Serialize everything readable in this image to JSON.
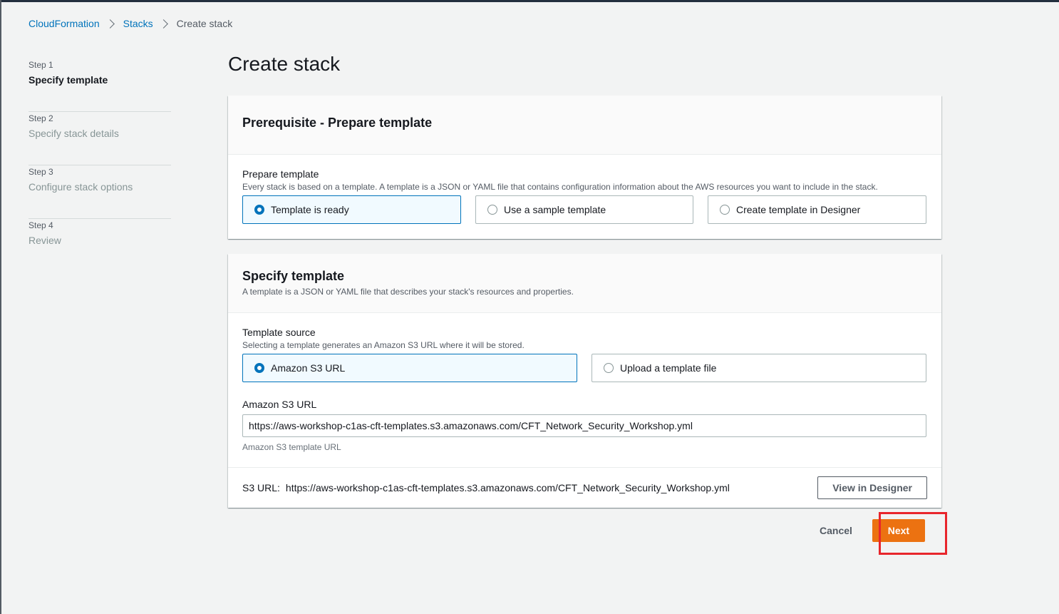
{
  "breadcrumb": {
    "items": [
      "CloudFormation",
      "Stacks"
    ],
    "current": "Create stack"
  },
  "steps": [
    {
      "num": "Step 1",
      "title": "Specify template",
      "active": true
    },
    {
      "num": "Step 2",
      "title": "Specify stack details",
      "active": false
    },
    {
      "num": "Step 3",
      "title": "Configure stack options",
      "active": false
    },
    {
      "num": "Step 4",
      "title": "Review",
      "active": false
    }
  ],
  "page": {
    "title": "Create stack"
  },
  "prereq": {
    "heading": "Prerequisite - Prepare template",
    "label": "Prepare template",
    "desc": "Every stack is based on a template. A template is a JSON or YAML file that contains configuration information about the AWS resources you want to include in the stack.",
    "options": [
      "Template is ready",
      "Use a sample template",
      "Create template in Designer"
    ],
    "selected": "Template is ready"
  },
  "specify": {
    "heading": "Specify template",
    "desc": "A template is a JSON or YAML file that describes your stack's resources and properties.",
    "source_label": "Template source",
    "source_desc": "Selecting a template generates an Amazon S3 URL where it will be stored.",
    "options": [
      "Amazon S3 URL",
      "Upload a template file"
    ],
    "selected": "Amazon S3 URL",
    "url_label": "Amazon S3 URL",
    "url_value": "https://aws-workshop-c1as-cft-templates.s3.amazonaws.com/CFT_Network_Security_Workshop.yml",
    "url_hint": "Amazon S3 template URL",
    "s3_label": "S3 URL:",
    "s3_value": "https://aws-workshop-c1as-cft-templates.s3.amazonaws.com/CFT_Network_Security_Workshop.yml",
    "view_designer": "View in Designer"
  },
  "actions": {
    "cancel": "Cancel",
    "next": "Next"
  },
  "colors": {
    "accent": "#0073bb",
    "primary": "#ec7211",
    "highlight": "#e8262c"
  }
}
